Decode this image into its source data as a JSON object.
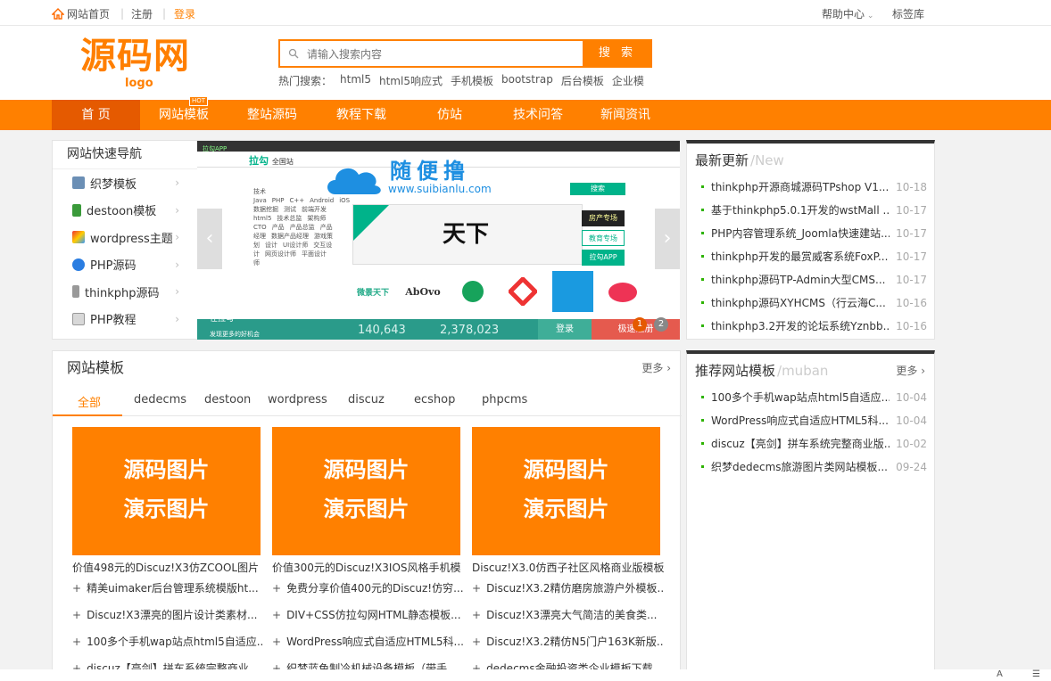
{
  "topbar": {
    "home": "网站首页",
    "register": "注册",
    "login": "登录",
    "help": "帮助中心",
    "tags": "标签库"
  },
  "logo": {
    "main": "源码网",
    "sub": "logo"
  },
  "search": {
    "placeholder": "请输入搜索内容",
    "button": "搜 索"
  },
  "hot": {
    "label": "热门搜索：",
    "terms": [
      "html5",
      "html5响应式",
      "手机模板",
      "bootstrap",
      "后台模板",
      "企业模"
    ]
  },
  "nav": {
    "items": [
      "首 页",
      "网站模板",
      "整站源码",
      "教程下载",
      "仿站",
      "技术问答",
      "新闻资讯"
    ],
    "badge": "HOT"
  },
  "quicknav": {
    "title": "网站快速导航",
    "items": [
      "织梦模板",
      "destoon模板",
      "wordpress主题",
      "PHP源码",
      "thinkphp源码",
      "PHP教程"
    ]
  },
  "banner": {
    "top_left": "拉勾APP",
    "site": "拉勾",
    "site_sub": "全国站",
    "wm_cn": "随便撸",
    "wm_url": "www.suibianlu.com",
    "search_btn": "搜索",
    "promo_title": "天下",
    "side": [
      "房产专场",
      "教育专场",
      "拉勾APP"
    ],
    "cats": [
      "技术",
      "Java",
      "PHP",
      "C++",
      "Android",
      "iOS",
      "数据挖掘",
      "测试",
      "前端开发",
      "html5",
      "技术总监",
      "架构师",
      "CTO",
      "产品",
      "产品总监",
      "产品经理",
      "数据产品经理",
      "游戏策划",
      "设计",
      "UI设计师",
      "交互设计",
      "网页设计师",
      "平面设计师"
    ],
    "brands": [
      "微景天下",
      "AbOvo",
      "",
      "",
      "",
      ""
    ],
    "counts": [
      "140,643",
      "2,378,023"
    ],
    "footer_left": "在拉勾",
    "footer_sub": "发现更多的好机会",
    "login": "登录",
    "reg": "极速注册",
    "dots": [
      "1",
      "2"
    ]
  },
  "updates": {
    "title": "最新更新",
    "en": "/New",
    "items": [
      {
        "t": "thinkphp开源商城源码TPshop V1...",
        "d": "10-18"
      },
      {
        "t": "基于thinkphp5.0.1开发的wstMall ...",
        "d": "10-17"
      },
      {
        "t": "PHP内容管理系统_Joomla快速建站...",
        "d": "10-17"
      },
      {
        "t": "thinkphp开发的最赏威客系统FoxP...",
        "d": "10-17"
      },
      {
        "t": "thinkphp源码TP-Admin大型CMS...",
        "d": "10-17"
      },
      {
        "t": "thinkphp源码XYHCMS（行云海C...",
        "d": "10-16"
      },
      {
        "t": "thinkphp3.2开发的论坛系统Yznbb...",
        "d": "10-16"
      }
    ]
  },
  "templates": {
    "title": "网站模板",
    "more": "更多",
    "tabs": [
      "全部",
      "dedecms",
      "destoon",
      "wordpress",
      "discuz",
      "ecshop",
      "phpcms"
    ],
    "card_line1": "源码图片",
    "card_line2": "演示图片",
    "cards": [
      "价值498元的Discuz!X3仿ZCOOL图片",
      "价值300元的Discuz!X3IOS风格手机模",
      "Discuz!X3.0仿西子社区风格商业版模板"
    ],
    "subs": [
      [
        "精美uimaker后台管理系统模版ht...",
        "免费分享价值400元的Discuz!仿穷...",
        "Discuz!X3.2精仿磨房旅游户外模板..."
      ],
      [
        "Discuz!X3漂亮的图片设计类素材...",
        "DIV+CSS仿拉勾网HTML静态模板...",
        "Discuz!X3漂亮大气简洁的美食类..."
      ],
      [
        "100多个手机wap站点html5自适应...",
        "WordPress响应式自适应HTML5科...",
        "Discuz!X3.2精仿N5门户163K新版..."
      ],
      [
        "discuz【亮剑】拼车系统完整商业...",
        "织梦蓝色制冷机械设备模板（带手...",
        "dedecms金融投资类企业模板下载"
      ]
    ],
    "plus": "+"
  },
  "recommend": {
    "title": "推荐网站模板",
    "en": "/muban",
    "more": "更多",
    "items": [
      {
        "t": "100多个手机wap站点html5自适应...",
        "d": "10-04"
      },
      {
        "t": "WordPress响应式自适应HTML5科...",
        "d": "10-04"
      },
      {
        "t": "discuz【亮剑】拼车系统完整商业版...",
        "d": "10-02"
      },
      {
        "t": "织梦dedecms旅游图片类网站模板...",
        "d": "09-24"
      }
    ]
  },
  "colors": {
    "accent": "#ff8000",
    "nav_active": "#e55a00",
    "dot": "#2db300"
  }
}
